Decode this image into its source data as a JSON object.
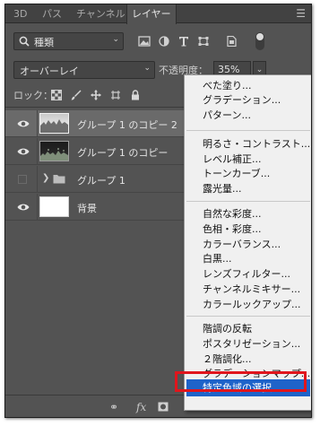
{
  "tabs": [
    {
      "label": "3D",
      "active": false
    },
    {
      "label": "パス",
      "active": false
    },
    {
      "label": "チャンネル",
      "active": false
    },
    {
      "label": "レイヤー",
      "active": true
    }
  ],
  "filter": {
    "kind_label": "種類"
  },
  "blend": {
    "mode": "オーバーレイ",
    "opacity_label": "不透明度：",
    "opacity_value": "35%"
  },
  "lock": {
    "label": "ロック："
  },
  "layers": [
    {
      "name": "グループ 1 のコピー 2",
      "visible": true,
      "thumb": "light",
      "selected": true
    },
    {
      "name": "グループ 1 のコピー",
      "visible": true,
      "thumb": "dark",
      "selected": false
    },
    {
      "name": "グループ 1",
      "visible": false,
      "thumb": "folder",
      "selected": false
    },
    {
      "name": "背景",
      "visible": true,
      "thumb": "white",
      "selected": false
    }
  ],
  "bottom_bar": {
    "fx_label": "fx"
  },
  "adjustment_menu": {
    "groups": [
      [
        "べた塗り...",
        "グラデーション...",
        "パターン..."
      ],
      [
        "明るさ・コントラスト...",
        "レベル補正...",
        "トーンカーブ...",
        "露光量..."
      ],
      [
        "自然な彩度...",
        "色相・彩度...",
        "カラーバランス...",
        "白黒...",
        "レンズフィルター...",
        "チャンネルミキサー...",
        "カラールックアップ..."
      ],
      [
        "階調の反転",
        "ポスタリゼーション...",
        "２階調化...",
        "グラデーションマップ..."
      ]
    ],
    "selected_item": "特定色域の選択...",
    "highlight_color": "#1e63c9",
    "annotation_color": "#e0151c"
  }
}
